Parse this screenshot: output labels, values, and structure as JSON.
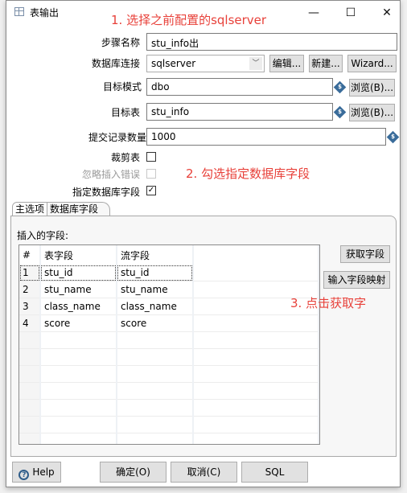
{
  "window": {
    "title": "表输出",
    "minimize": "—",
    "maximize": "☐",
    "close": "✕"
  },
  "annotations": {
    "a1": "1. 选择之前配置的sqlserver",
    "a2": "2. 勾选指定数据库字段",
    "a3": "3. 点击获取字"
  },
  "form": {
    "step_name_label": "步骤名称",
    "step_name_value": "stu_info出",
    "connection_label": "数据库连接",
    "connection_value": "sqlserver",
    "edit_button": "编辑...",
    "new_button": "新建...",
    "wizard_button": "Wizard...",
    "schema_label": "目标模式",
    "schema_value": "dbo",
    "browse_button": "浏览(B)...",
    "table_label": "目标表",
    "table_value": "stu_info",
    "commit_label": "提交记录数量",
    "commit_value": "1000",
    "truncate_label": "裁剪表",
    "truncate_checked": false,
    "ignore_errors_label": "忽略插入错误",
    "ignore_errors_checked": false,
    "specify_fields_label": "指定数据库字段",
    "specify_fields_checked": true,
    "variable_icon": "$"
  },
  "tabs": [
    {
      "label": "主选项",
      "active": false
    },
    {
      "label": "数据库字段",
      "active": true
    }
  ],
  "fields_panel": {
    "title": "插入的字段:",
    "columns": [
      "#",
      "表字段",
      "流字段"
    ],
    "rows": [
      {
        "num": "1",
        "table_field": "stu_id",
        "stream_field": "stu_id"
      },
      {
        "num": "2",
        "table_field": "stu_name",
        "stream_field": "stu_name"
      },
      {
        "num": "3",
        "table_field": "class_name",
        "stream_field": "class_name"
      },
      {
        "num": "4",
        "table_field": "score",
        "stream_field": "score"
      }
    ],
    "get_fields_button": "获取字段",
    "mapping_button": "输入字段映射"
  },
  "footer": {
    "help": "Help",
    "ok": "确定(O)",
    "cancel": "取消(C)",
    "sql": "SQL"
  }
}
